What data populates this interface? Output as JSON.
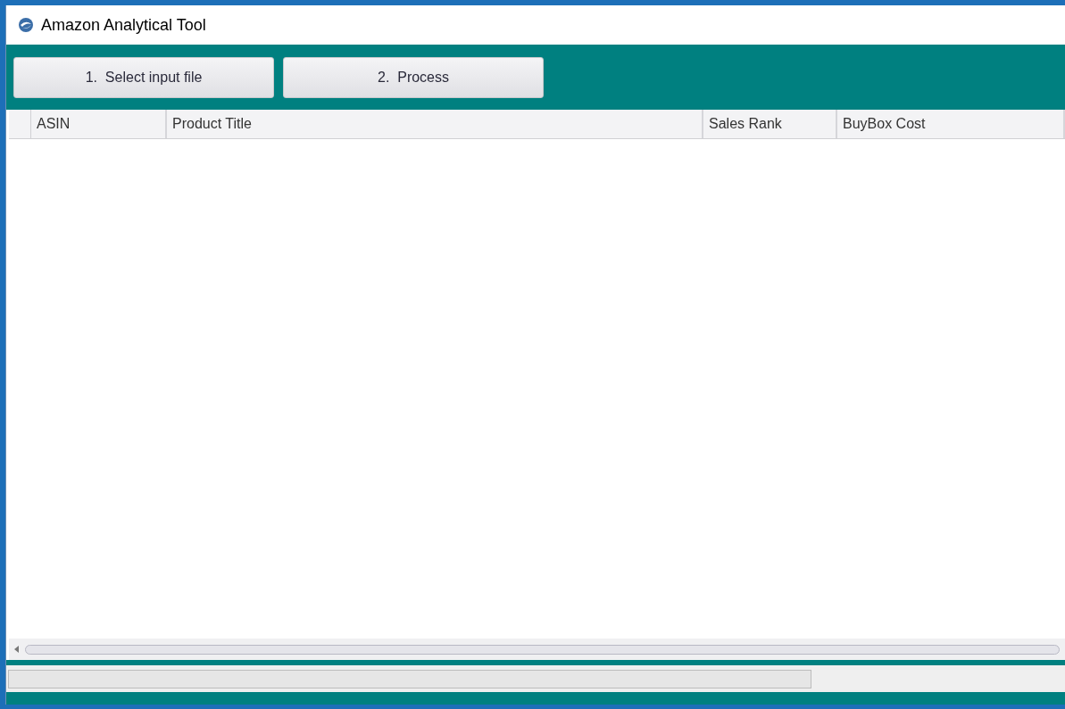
{
  "window": {
    "title": "Amazon Analytical Tool"
  },
  "toolbar": {
    "buttons": [
      "1.  Select input file",
      "2.  Process"
    ]
  },
  "table": {
    "columns": [
      "ASIN",
      "Product Title",
      "Sales Rank",
      "BuyBox Cost"
    ]
  },
  "status_bar": {
    "progress": {
      "level": 0
    }
  }
}
